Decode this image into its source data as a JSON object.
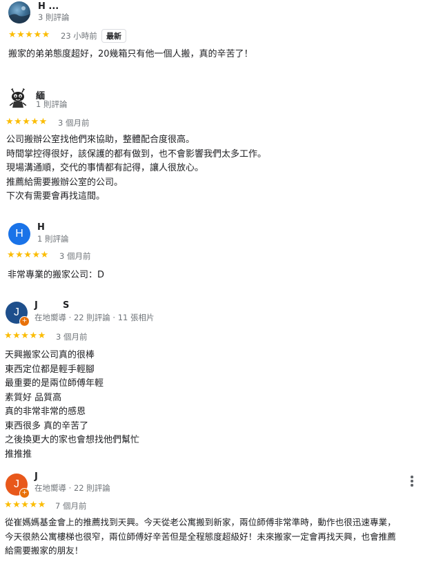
{
  "colors": {
    "star": "#fbbc04",
    "avatar_blue": "#1a73e8",
    "avatar_navy": "#1e4f8c",
    "avatar_orange": "#e8581b",
    "local_guide": "#e8710a"
  },
  "reviews": [
    {
      "name": "H ...",
      "meta": "3 則評論",
      "stars": "★★★★★",
      "rating": 5,
      "time": "23 小時前",
      "badge": "最新",
      "lines": [
        "搬家的弟弟態度超好，20幾箱只有他一個人搬，真的辛苦了！"
      ]
    },
    {
      "name": "緬",
      "meta": "1 則評論",
      "stars": "★★★★★",
      "rating": 5,
      "time": "3 個月前",
      "lines": [
        "公司搬辦公室找他們來協助，整體配合度很高。",
        "時間掌控得很好，該保護的都有做到，也不會影響我們太多工作。",
        "現場溝通順，交代的事情都有記得，讓人很放心。",
        "推薦給需要搬辦公室的公司。",
        "下次有需要會再找這間。"
      ]
    },
    {
      "name": "H",
      "avatar_letter": "H",
      "meta": "1 則評論",
      "stars": "★★★★★",
      "rating": 5,
      "time": "3 個月前",
      "lines": [
        "非常專業的搬家公司：D"
      ]
    },
    {
      "name": "J        S",
      "avatar_letter": "J",
      "meta": "在地嚮導 · 22 則評論 · 11 張相片",
      "stars": "★★★★★",
      "rating": 5,
      "time": "3 個月前",
      "lines": [
        "天興搬家公司真的很棒",
        "東西定位都是輕手輕腳",
        "最重要的是兩位師傅年輕",
        "素質好 品質高",
        "真的非常非常的感恩",
        "東西很多 真的辛苦了",
        "之後換更大的家也會想找他們幫忙",
        "推推推"
      ]
    },
    {
      "name": "J",
      "avatar_letter": "J",
      "meta": "在地嚮導 · 22 則評論",
      "stars": "★★★★★",
      "rating": 5,
      "time": "7 個月前",
      "lines": [
        "從崔媽媽基金會上的推薦找到天興。今天從老公寓搬到新家，兩位師傅非常準時，動作也很迅速專業，",
        "今天很熱公寓樓梯也很窄，兩位師傅好辛苦但是全程態度超級好！未來搬家一定會再找天興，也會推薦",
        "給需要搬家的朋友！"
      ]
    }
  ]
}
